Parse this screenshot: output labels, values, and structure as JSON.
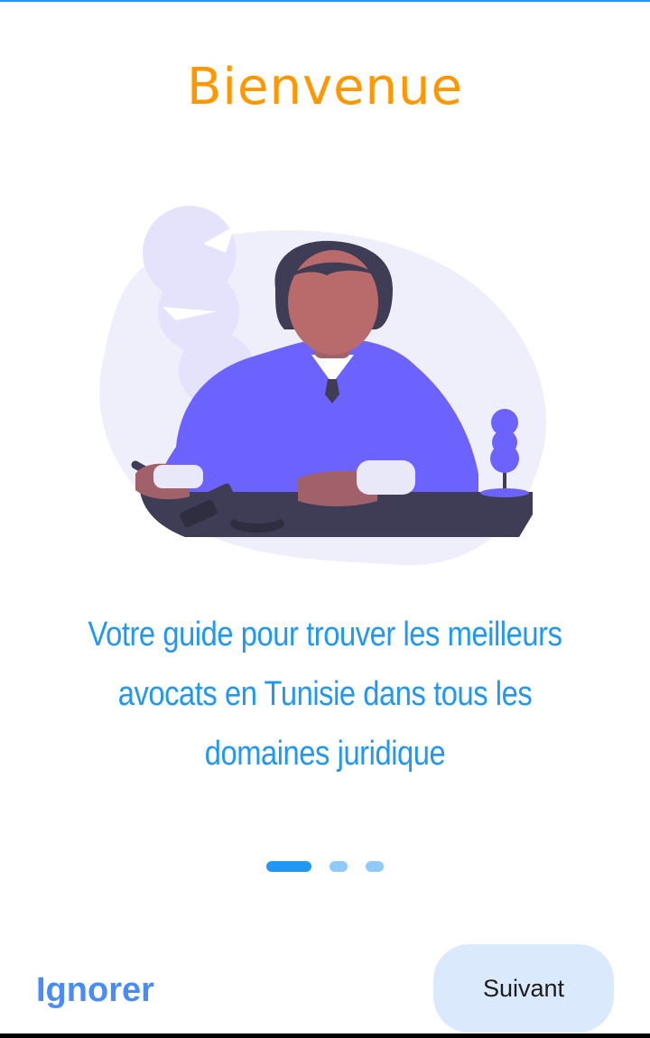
{
  "onboarding": {
    "title": "Bienvenue",
    "tagline": "Votre guide pour trouver les meilleurs avocats en Tunisie dans tous les domaines juridique",
    "illustration_icon": "lawyer-at-desk-illustration",
    "page_indicator": {
      "current": 1,
      "total": 3
    },
    "skip_label": "Ignorer",
    "next_label": "Suivant"
  },
  "colors": {
    "title": "#ff9800",
    "tagline": "#2196f3",
    "skip": "#4a8cf7",
    "next_bg": "#dbe9fd",
    "dot_active": "#2196f3",
    "dot_inactive": "#90caf9",
    "illustration_primary": "#6c63ff",
    "illustration_dark": "#3f3d56"
  }
}
